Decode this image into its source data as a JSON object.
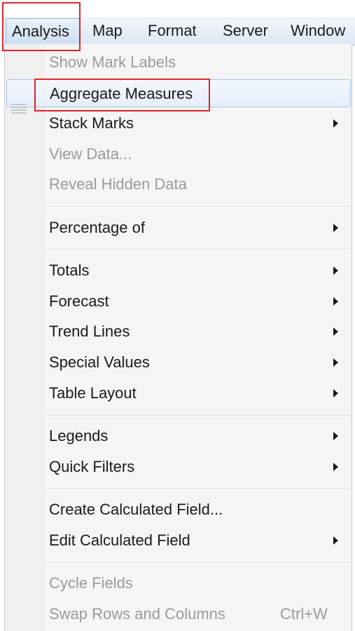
{
  "menubar": {
    "items": [
      "Analysis",
      "Map",
      "Format",
      "Server",
      "Window"
    ],
    "active_item": "Analysis"
  },
  "menu": {
    "items": [
      {
        "label": "Show Mark Labels",
        "enabled": false,
        "submenu": false,
        "shortcut": ""
      },
      {
        "label": "Aggregate Measures",
        "enabled": true,
        "submenu": false,
        "shortcut": "",
        "highlighted": true
      },
      {
        "label": "Stack Marks",
        "enabled": true,
        "submenu": true,
        "shortcut": ""
      },
      {
        "label": "View Data...",
        "enabled": false,
        "submenu": false,
        "shortcut": "",
        "icon": "view-data-icon"
      },
      {
        "label": "Reveal Hidden Data",
        "enabled": false,
        "submenu": false,
        "shortcut": ""
      },
      {
        "label": "Percentage of",
        "enabled": true,
        "submenu": true,
        "shortcut": ""
      },
      {
        "label": "Totals",
        "enabled": true,
        "submenu": true,
        "shortcut": ""
      },
      {
        "label": "Forecast",
        "enabled": true,
        "submenu": true,
        "shortcut": ""
      },
      {
        "label": "Trend Lines",
        "enabled": true,
        "submenu": true,
        "shortcut": ""
      },
      {
        "label": "Special Values",
        "enabled": true,
        "submenu": true,
        "shortcut": ""
      },
      {
        "label": "Table Layout",
        "enabled": true,
        "submenu": true,
        "shortcut": ""
      },
      {
        "label": "Legends",
        "enabled": true,
        "submenu": true,
        "shortcut": ""
      },
      {
        "label": "Quick Filters",
        "enabled": true,
        "submenu": true,
        "shortcut": ""
      },
      {
        "label": "Create Calculated Field...",
        "enabled": true,
        "submenu": false,
        "shortcut": ""
      },
      {
        "label": "Edit Calculated Field",
        "enabled": true,
        "submenu": true,
        "shortcut": ""
      },
      {
        "label": "Cycle Fields",
        "enabled": false,
        "submenu": false,
        "shortcut": ""
      },
      {
        "label": "Swap Rows and Columns",
        "enabled": false,
        "submenu": false,
        "shortcut": "Ctrl+W"
      }
    ]
  },
  "colors": {
    "annotation_red": "#e0242b",
    "hover_border": "#a9c3e3",
    "disabled_text": "#9a9a9a"
  }
}
